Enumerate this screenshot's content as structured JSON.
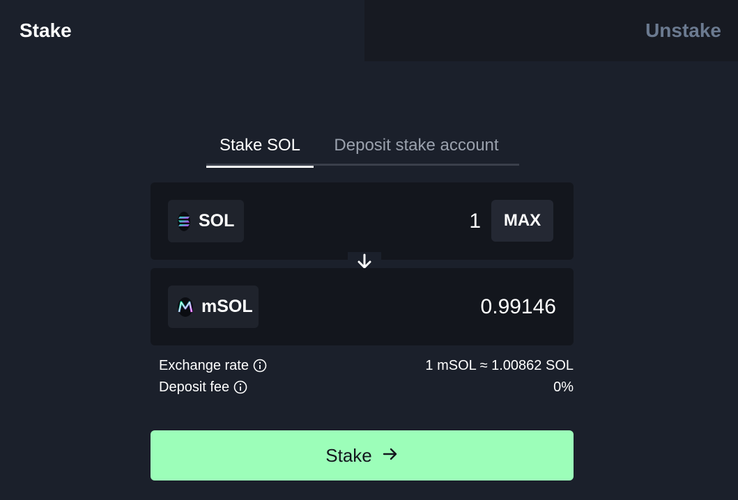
{
  "mode_tabs": {
    "stake": "Stake",
    "unstake": "Unstake"
  },
  "sub_tabs": {
    "active": "Stake SOL",
    "inactive": "Deposit stake account"
  },
  "from": {
    "token": "SOL",
    "amount": "1",
    "max_label": "MAX"
  },
  "to": {
    "token": "mSOL",
    "amount": "0.99146"
  },
  "info": {
    "exchange_rate_label": "Exchange rate",
    "exchange_rate_value": "1 mSOL ≈ 1.00862 SOL",
    "deposit_fee_label": "Deposit fee",
    "deposit_fee_value": "0%"
  },
  "cta": {
    "label": "Stake"
  },
  "icons": {
    "swap_direction": "arrow-down-icon",
    "info": "info-icon",
    "cta_arrow": "arrow-right-icon",
    "sol_logo": "solana-logo-icon",
    "msol_logo": "msol-logo-icon"
  },
  "colors": {
    "accent": "#9cfeb9",
    "background": "#1b202b",
    "panel": "#13161d",
    "muted": "#6b7a90"
  }
}
